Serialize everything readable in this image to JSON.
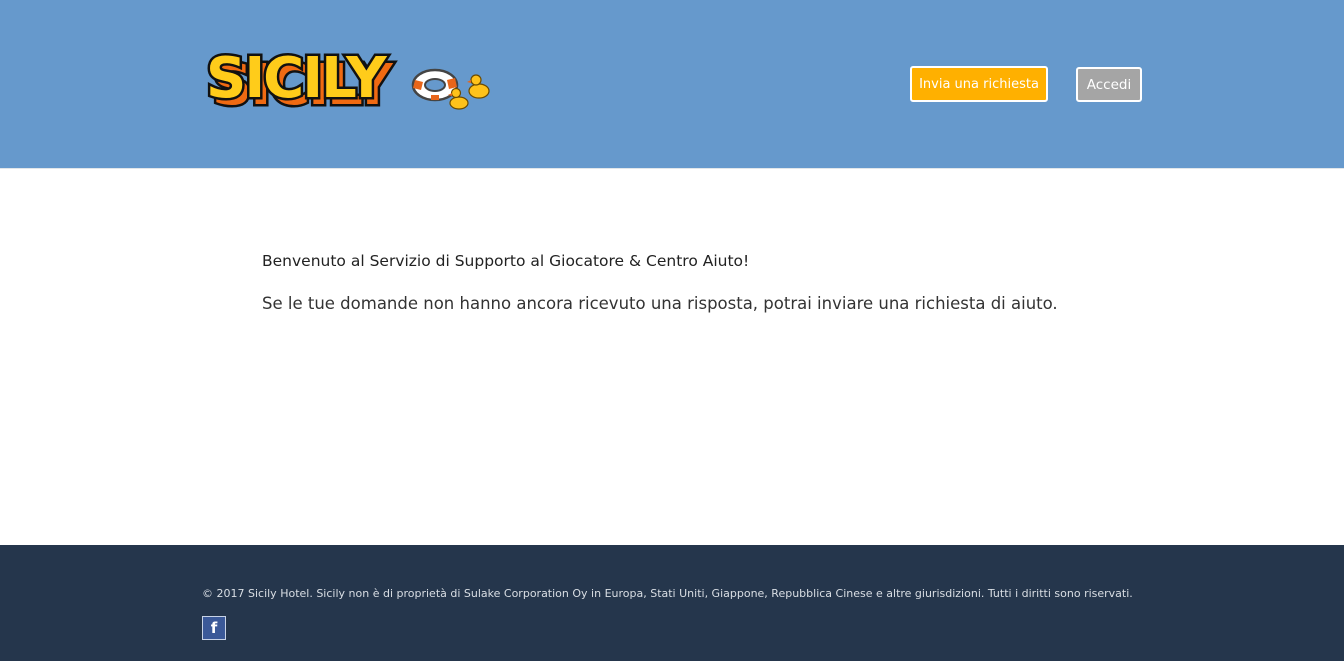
{
  "header": {
    "logo": {
      "text": "SICILY",
      "icon": "lifebuoy-ducks-icon"
    },
    "request_button_label": "Invia una richiesta",
    "login_button_label": "Accedi"
  },
  "main": {
    "title": "Benvenuto al Servizio di Supporto al Giocatore & Centro Aiuto!",
    "text": "Se le tue domande non hanno ancora ricevuto una risposta, potrai inviare una richiesta di aiuto."
  },
  "footer": {
    "copyright": "© 2017 Sicily Hotel. Sicily non è di proprietà di Sulake Corporation Oy in Europa, Stati Uniti, Giappone, Repubblica Cinese e altre giurisdizioni. Tutti i diritti sono riservati.",
    "social": {
      "facebook_glyph": "f",
      "icon": "facebook-icon"
    }
  },
  "colors": {
    "header_bg": "#6699cc",
    "request_button": "#ffb000",
    "login_button": "#a5a5a5",
    "footer_bg": "#25364c"
  }
}
